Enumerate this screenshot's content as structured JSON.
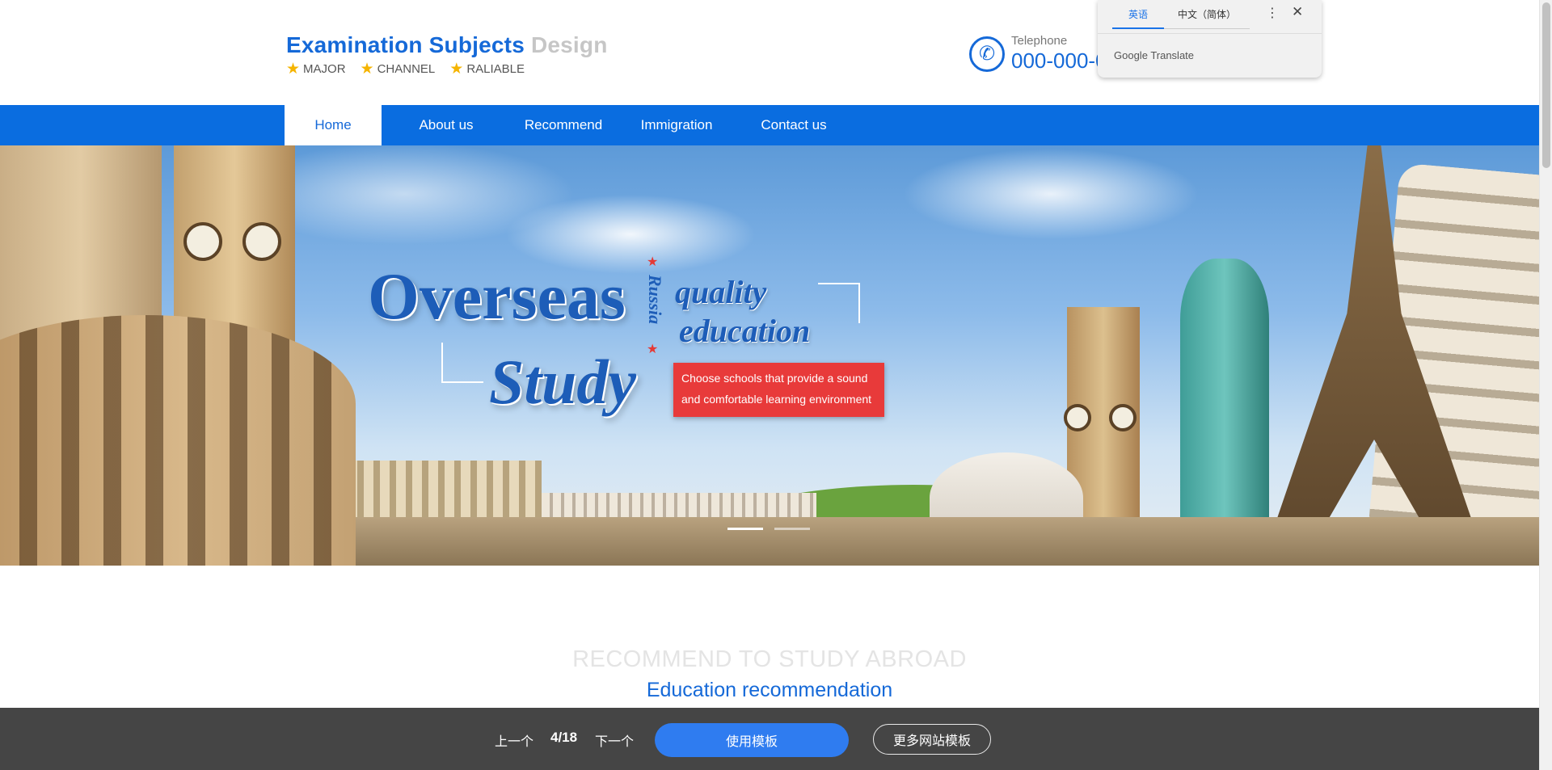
{
  "brand": {
    "title_main": "Examination Subjects",
    "title_accent": "Design",
    "tags": [
      "MAJOR",
      "CHANNEL",
      "RALIABLE"
    ]
  },
  "phone": {
    "label": "Telephone",
    "number": "000-000-0",
    "icon": "phone-icon"
  },
  "translate": {
    "tabs": [
      "英语",
      "中文（简体）"
    ],
    "active_tab": "英语",
    "brand": "Google",
    "brand_suffix": "Translate",
    "menu_icon": "more-vert-icon",
    "close_icon": "close-icon"
  },
  "nav": {
    "items": [
      {
        "label": "Home",
        "active": true
      },
      {
        "label": "About us",
        "active": false
      },
      {
        "label": "Recommend",
        "active": false
      },
      {
        "label": "Immigration",
        "active": false
      },
      {
        "label": "Contact us",
        "active": false
      }
    ]
  },
  "banner": {
    "headline_1": "Overseas",
    "headline_2": "Study",
    "vertical_text": "Russia",
    "sub_1": "quality",
    "sub_2": "education",
    "callout": "Choose schools that provide a sound and comfortable learning environment",
    "slides_total": 2,
    "active_slide": 1
  },
  "section": {
    "eyebrow": "RECOMMEND TO STUDY ABROAD",
    "title": "Education recommendation"
  },
  "bottom_bar": {
    "prev_label": "上一个",
    "page_indicator": "4/18",
    "next_label": "下一个",
    "use_template_label": "使用模板",
    "more_templates_label": "更多网站模板"
  },
  "colors": {
    "brand_blue": "#1569d8",
    "nav_blue": "#0a6de0",
    "callout_red": "#e83a3a",
    "star_gold": "#f5b400",
    "bottom_bar_bg": "#454545",
    "primary_button": "#2f7cf0"
  }
}
